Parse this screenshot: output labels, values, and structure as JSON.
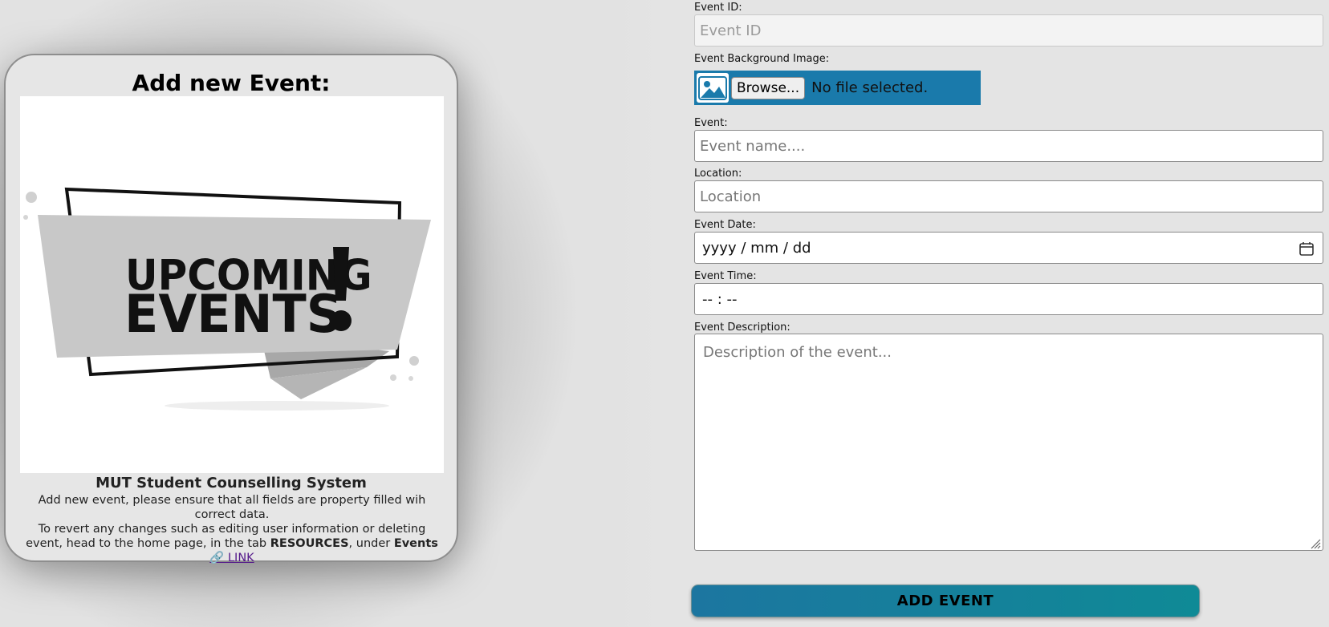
{
  "card": {
    "title": "Add new Event:",
    "image_text_line1": "UPCOMING",
    "image_text_line2": "EVENTS",
    "heading": "MUT Student Counselling System",
    "description_line1": "Add new event, please ensure that all fields are property filled wih correct data.",
    "description_line2_prefix": "To revert any changes such as editing user information or deleting event, head to the home page, in the tab ",
    "resources_label": "RESOURCES",
    "under_text": ", under ",
    "events_label": "Events",
    "link_label": "🔗 LINK"
  },
  "form": {
    "event_id": {
      "label": "Event ID:",
      "placeholder": "Event ID",
      "value": ""
    },
    "background_image": {
      "label": "Event Background Image:",
      "browse_label": "Browse...",
      "status": "No file selected."
    },
    "event_name": {
      "label": "Event:",
      "placeholder": "Event name....",
      "value": ""
    },
    "location": {
      "label": "Location:",
      "placeholder": "Location",
      "value": ""
    },
    "event_date": {
      "label": "Event Date:",
      "placeholder": "yyyy / mm / dd"
    },
    "event_time": {
      "label": "Event Time:",
      "placeholder": "-- : --"
    },
    "description": {
      "label": "Event Description:",
      "placeholder": "Description of the event..."
    },
    "submit_label": "ADD EVENT"
  },
  "colors": {
    "file_bar": "#1a7aab",
    "button_start": "#1c76a0",
    "button_end": "#0f8a96",
    "link": "#551a8b"
  },
  "icons": {
    "image": "image-icon",
    "calendar": "calendar-icon",
    "resize": "resize-grip-icon"
  }
}
